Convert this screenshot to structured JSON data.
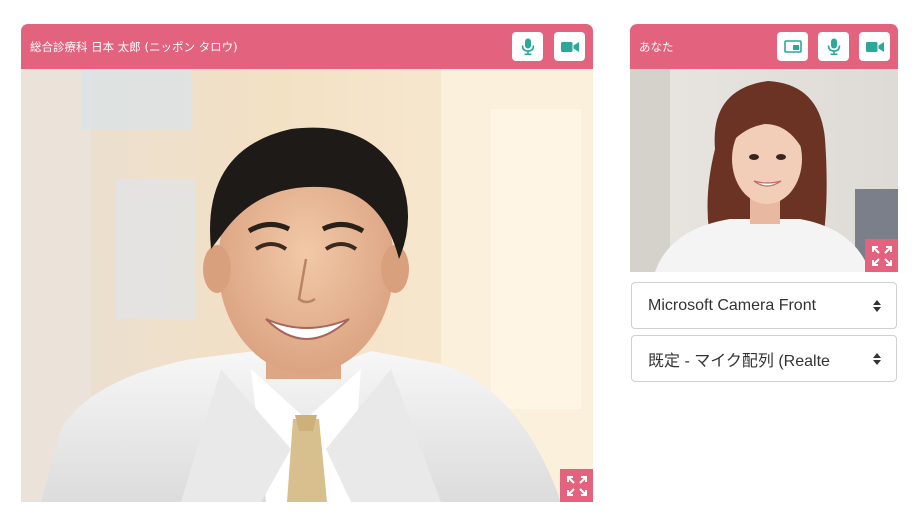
{
  "remote_panel": {
    "title": "総合診療科 日本 太郎 (ニッポン タロウ)",
    "icons": [
      "microphone-icon",
      "video-camera-icon"
    ],
    "fullscreen_icon": "expand-icon"
  },
  "self_panel": {
    "title": "あなた",
    "icons": [
      "screen-share-icon",
      "microphone-icon",
      "video-camera-icon"
    ],
    "fullscreen_icon": "expand-icon"
  },
  "devices": {
    "camera": "Microsoft Camera Front",
    "microphone": "既定 - マイク配列 (Realte"
  },
  "colors": {
    "accent": "#e3627d",
    "icon": "#2aa89a"
  }
}
